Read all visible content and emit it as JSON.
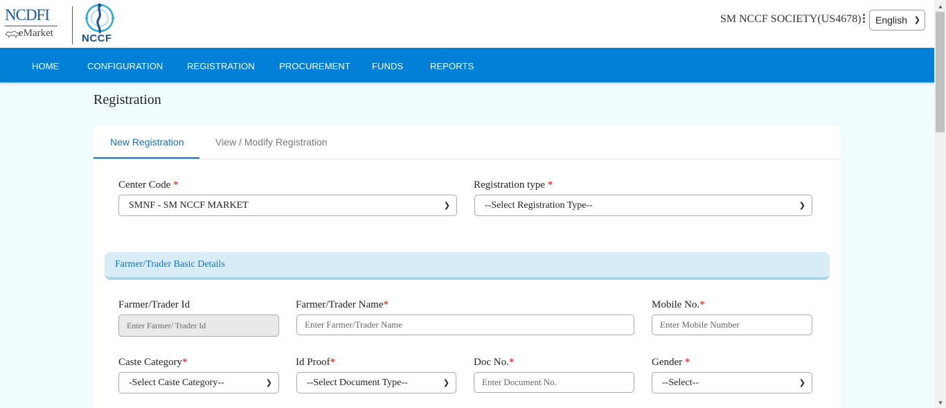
{
  "header": {
    "brand_ncdfi": "NCDFI",
    "brand_emarket": "eMarket",
    "brand_nccf": "NCCF",
    "user": "SM NCCF SOCIETY(US4678)",
    "language": "English"
  },
  "nav": [
    "HOME",
    "CONFIGURATION",
    "REGISTRATION",
    "PROCUREMENT",
    "FUNDS",
    "REPORTS"
  ],
  "page": {
    "title": "Registration"
  },
  "tabs": {
    "active": "New Registration",
    "inactive": "View / Modify Registration"
  },
  "form": {
    "center_code": {
      "label": "Center Code",
      "value": "SMNF - SM NCCF MARKET"
    },
    "registration_type": {
      "label": "Registration type",
      "value": "--Select Registration Type--"
    },
    "section_title": "Farmer/Trader Basic Details",
    "farmer_id": {
      "label": "Farmer/Trader Id",
      "placeholder": "Enter Farmer/ Trader Id"
    },
    "farmer_name": {
      "label": "Farmer/Trader Name",
      "placeholder": "Enter Farmer/Trader Name"
    },
    "mobile": {
      "label": "Mobile No.",
      "placeholder": "Enter Mobile Number"
    },
    "caste": {
      "label": "Caste Category",
      "value": "-Select Caste Category--"
    },
    "id_proof": {
      "label": "Id Proof",
      "value": "--Select Document Type--"
    },
    "doc_no": {
      "label": "Doc No.",
      "placeholder": "Enter Document No."
    },
    "gender": {
      "label": "Gender",
      "value": "--Select--"
    }
  },
  "required_mark": "*",
  "colors": {
    "nav": "#0280d7",
    "accent": "#1670c4",
    "required": "#ee0000",
    "page_bg": "#f0fcfd"
  },
  "icons": [
    "kebab-menu-icon",
    "chevron-down-icon"
  ]
}
